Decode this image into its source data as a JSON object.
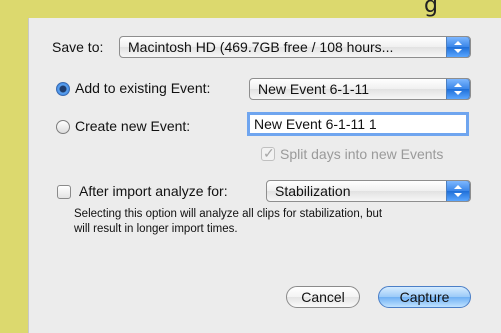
{
  "background_fragment": "g",
  "dialog": {
    "save_to": {
      "label": "Save to:",
      "value": "Macintosh HD (469.7GB free / 108 hours..."
    },
    "add_to_existing": {
      "label": "Add to existing Event:",
      "selected": true,
      "popup_value": "New Event 6-1-11"
    },
    "create_new": {
      "label": "Create new Event:",
      "selected": false,
      "field_value": "New Event 6-1-11 1"
    },
    "split_days": {
      "label": "Split days into new Events",
      "checked": true,
      "enabled": false
    },
    "analyze": {
      "label": "After import analyze for:",
      "checked": false,
      "popup_value": "Stabilization",
      "note_line1": "Selecting this option will analyze all clips for stabilization, but",
      "note_line2": "will result in longer import times."
    },
    "buttons": {
      "cancel": "Cancel",
      "capture": "Capture"
    }
  }
}
